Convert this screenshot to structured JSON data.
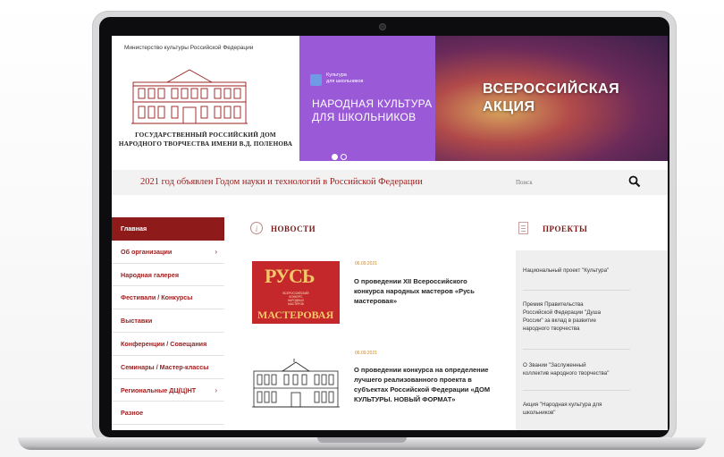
{
  "device": {
    "model_lines": [
      "MacBook Pro"
    ]
  },
  "header": {
    "ministry": "Министерство культуры Российской Федерации",
    "org_name_lines": [
      "ГОСУДАРСТВЕННЫЙ РОССИЙСКИЙ ДОМ",
      "НАРОДНОГО ТВОРЧЕСТВА ИМЕНИ В.Д. ПОЛЕНОВА"
    ]
  },
  "banner": {
    "mini_lines": [
      "Культура",
      "для школьников"
    ],
    "title_lines": [
      "НАРОДНАЯ КУЛЬТУРА",
      "ДЛЯ ШКОЛЬНИКОВ"
    ],
    "big_lines": [
      "ВСЕРОССИЙСКАЯ",
      "АКЦИЯ"
    ],
    "slide_count": 2,
    "active_slide": 1
  },
  "announcement": "2021 год объявлен Годом науки и технологий в Российской Федерации",
  "search": {
    "placeholder": "Поиск"
  },
  "nav": {
    "items": [
      {
        "label": "Главная",
        "active": true,
        "has_children": false
      },
      {
        "label": "Об организации",
        "active": false,
        "has_children": true
      },
      {
        "label": "Народная галерея",
        "active": false,
        "has_children": false
      },
      {
        "label": "Фестивали / Конкурсы",
        "active": false,
        "has_children": false
      },
      {
        "label": "Выставки",
        "active": false,
        "has_children": false
      },
      {
        "label": "Конференции / Совещания",
        "active": false,
        "has_children": false
      },
      {
        "label": "Семинары / Мастер-классы",
        "active": false,
        "has_children": false
      },
      {
        "label": "Региональные ДЦ(Ц)НТ",
        "active": false,
        "has_children": true
      },
      {
        "label": "Разное",
        "active": false,
        "has_children": false
      }
    ],
    "chevron": "›"
  },
  "news": {
    "heading": "НОВОСТИ",
    "icon_letter": "i",
    "items": [
      {
        "date": "06.09.2021",
        "title_lines": [
          "О проведении XII Всероссийского",
          "конкурса народных мастеров «Русь",
          "мастеровая»"
        ],
        "image": {
          "big": "РУСЬ",
          "small_lines": [
            "ВСЕРОССИЙСКИЙ",
            "КОНКУРС",
            "НАРОДНЫХ МАСТЕРОВ"
          ],
          "bottom": "МАСТЕРОВАЯ"
        }
      },
      {
        "date": "06.09.2021",
        "title_lines": [
          "О проведении конкурса на определение",
          "лучшего реализованного проекта в",
          "субъектах Российской Федерации «ДОМ",
          "КУЛЬТУРЫ. НОВЫЙ ФОРМАТ»"
        ]
      }
    ]
  },
  "projects": {
    "heading": "ПРОЕКТЫ",
    "items": [
      {
        "lines": [
          "Национальный проект \"Культура\""
        ]
      },
      {
        "lines": [
          "Премия Правительства",
          "Российской Федерации \"Душа",
          "России\" за вклад в развитие",
          "народного творчества"
        ]
      },
      {
        "lines": [
          "О Звании \"Заслуженный",
          "коллектив народного творчества\""
        ]
      },
      {
        "lines": [
          "Акция \"Народная культура для",
          "школьников\""
        ]
      }
    ]
  },
  "colors": {
    "brand_red": "#9b1c1c",
    "nav_active": "#8f1a1a",
    "banner_purple": "#9a5ad8",
    "date_orange": "#c9862a"
  }
}
